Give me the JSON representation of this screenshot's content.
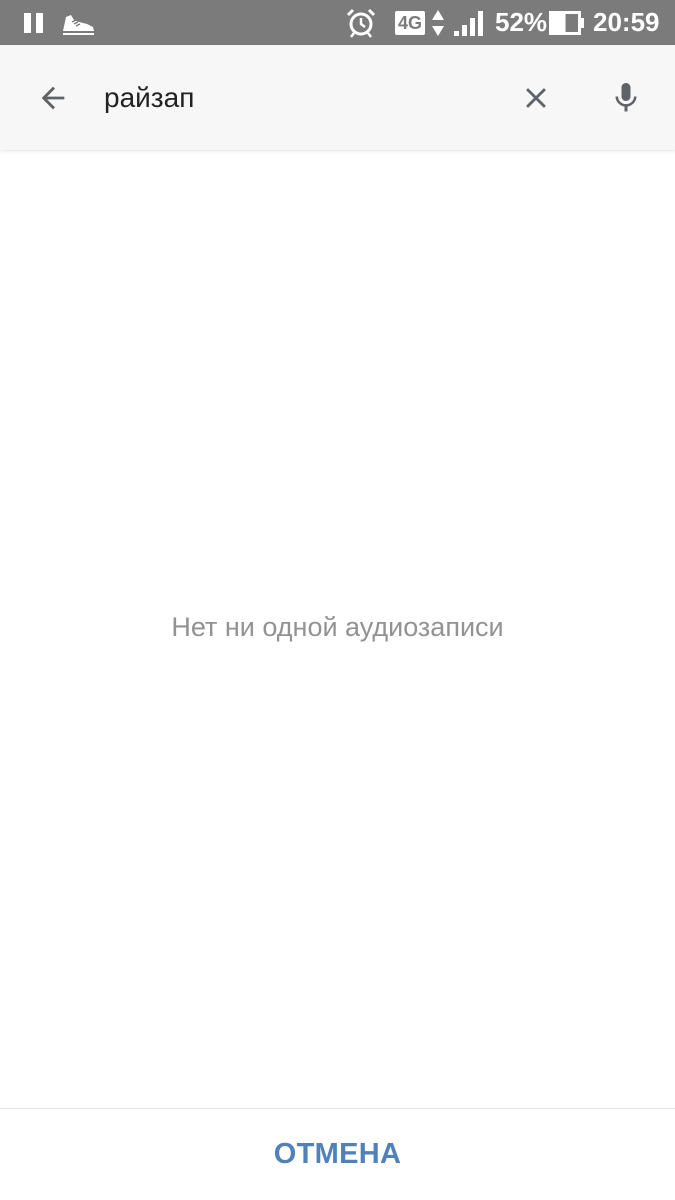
{
  "status_bar": {
    "icons": [
      "pause-icon",
      "sneaker-icon",
      "alarm-icon",
      "network-4g-icon",
      "data-arrows-icon",
      "signal-icon",
      "battery-icon"
    ],
    "network_label": "4G",
    "battery_percent": "52%",
    "battery_level": 0.52,
    "time": "20:59"
  },
  "search": {
    "query": "райзап",
    "icons": [
      "back-arrow-icon",
      "clear-icon",
      "microphone-icon"
    ]
  },
  "main": {
    "empty_message": "Нет ни одной аудиозаписи"
  },
  "footer": {
    "cancel_label": "ОТМЕНА"
  },
  "colors": {
    "status_bar": "#7b7b7b",
    "toolbar": "#f7f7f7",
    "accent": "#5181b8",
    "muted_text": "#929292",
    "icon": "#5f6368"
  }
}
